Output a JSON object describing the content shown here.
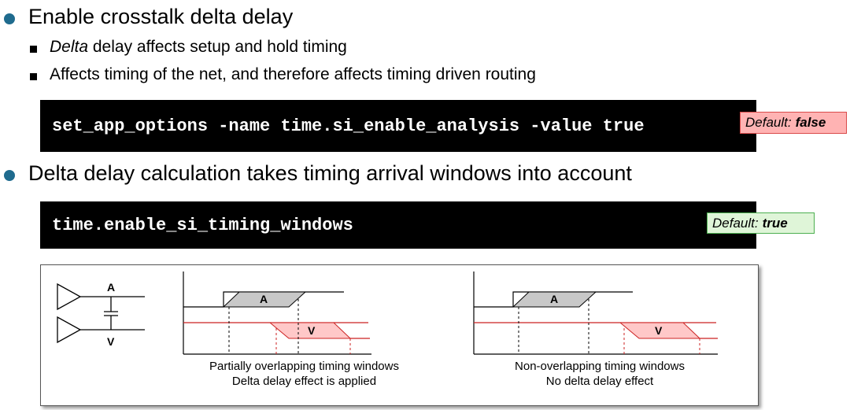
{
  "bullets": [
    {
      "text": "Enable crosstalk delta delay",
      "subitems": [
        {
          "italic": "Delta",
          "rest": " delay affects setup and hold timing"
        },
        {
          "italic": "",
          "rest": "Affects timing of the net, and therefore affects timing driven routing"
        }
      ],
      "code": "set_app_options -name time.si_enable_analysis -value true",
      "default_label": "Default:",
      "default_value": "false"
    },
    {
      "text": "Delta delay calculation takes timing arrival windows into account",
      "code": "time.enable_si_timing_windows",
      "default_label": "Default:",
      "default_value": "true"
    }
  ],
  "figure": {
    "circuit": {
      "net_a": "A",
      "net_v": "V"
    },
    "left_diagram": {
      "window_a": "A",
      "window_v": "V",
      "caption_line1": "Partially overlapping timing windows",
      "caption_line2": "Delta delay effect is applied"
    },
    "right_diagram": {
      "window_a": "A",
      "window_v": "V",
      "caption_line1": "Non-overlapping timing windows",
      "caption_line2": "No delta delay effect"
    }
  },
  "colors": {
    "bullet": "#1f6b8e",
    "victim_line": "#cc2222",
    "victim_fill": "#ffc8c8",
    "aggressor_fill": "#c8c8c8",
    "badge_false_bg": "#ffb3b3",
    "badge_true_bg": "#dff5d8"
  }
}
